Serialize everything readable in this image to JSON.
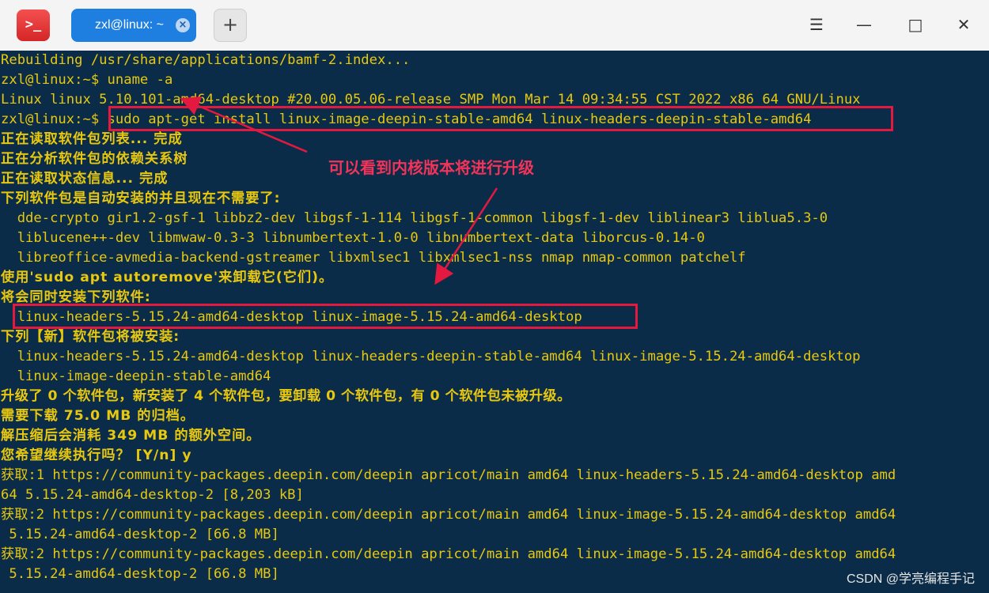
{
  "window": {
    "app_icon_glyph": ">_",
    "tab_title": "zxl@linux: ~",
    "tab_close_glyph": "×",
    "new_tab_glyph": "+",
    "menu_glyph": "☰",
    "minimize_glyph": "—",
    "maximize_glyph": "□",
    "close_glyph": "✕"
  },
  "colors": {
    "terminal_bg": "#0b2c48",
    "text": "#e8c80f",
    "highlight": "#e4193f",
    "tab_active": "#1f7fe0"
  },
  "terminal": {
    "lines": [
      "Rebuilding /usr/share/applications/bamf-2.index...",
      "zxl@linux:~$ uname -a",
      "Linux linux 5.10.101-amd64-desktop #20.00.05.06-release SMP Mon Mar 14 09:34:55 CST 2022 x86_64 GNU/Linux",
      "zxl@linux:~$ sudo apt-get install linux-image-deepin-stable-amd64 linux-headers-deepin-stable-amd64",
      "正在读取软件包列表... 完成",
      "正在分析软件包的依赖关系树",
      "正在读取状态信息... 完成",
      "下列软件包是自动安装的并且现在不需要了:",
      "  dde-crypto gir1.2-gsf-1 libbz2-dev libgsf-1-114 libgsf-1-common libgsf-1-dev liblinear3 liblua5.3-0",
      "  liblucene++-dev libmwaw-0.3-3 libnumbertext-1.0-0 libnumbertext-data liborcus-0.14-0",
      "  libreoffice-avmedia-backend-gstreamer libxmlsec1 libxmlsec1-nss nmap nmap-common patchelf",
      "使用'sudo apt autoremove'来卸载它(它们)。",
      "将会同时安装下列软件:",
      "  linux-headers-5.15.24-amd64-desktop linux-image-5.15.24-amd64-desktop",
      "下列【新】软件包将被安装:",
      "  linux-headers-5.15.24-amd64-desktop linux-headers-deepin-stable-amd64 linux-image-5.15.24-amd64-desktop",
      "  linux-image-deepin-stable-amd64",
      "升级了 0 个软件包，新安装了 4 个软件包，要卸载 0 个软件包，有 0 个软件包未被升级。",
      "需要下载 75.0 MB 的归档。",
      "解压缩后会消耗 349 MB 的额外空间。",
      "您希望继续执行吗？ [Y/n] y",
      "获取:1 https://community-packages.deepin.com/deepin apricot/main amd64 linux-headers-5.15.24-amd64-desktop amd",
      "64 5.15.24-amd64-desktop-2 [8,203 kB]",
      "获取:2 https://community-packages.deepin.com/deepin apricot/main amd64 linux-image-5.15.24-amd64-desktop amd64",
      " 5.15.24-amd64-desktop-2 [66.8 MB]",
      "获取:2 https://community-packages.deepin.com/deepin apricot/main amd64 linux-image-5.15.24-amd64-desktop amd64",
      " 5.15.24-amd64-desktop-2 [66.8 MB]"
    ]
  },
  "annotation": {
    "text": "可以看到内核版本将进行升级"
  },
  "watermark": "CSDN @学亮编程手记"
}
